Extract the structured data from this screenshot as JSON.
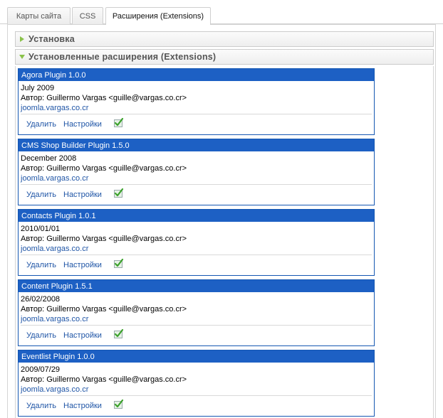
{
  "tabs": [
    {
      "label": "Карты сайта",
      "active": false
    },
    {
      "label": "CSS",
      "active": false
    },
    {
      "label": "Расширения (Extensions)",
      "active": true
    }
  ],
  "sections": {
    "install": {
      "title": "Установка",
      "expanded": false
    },
    "installed": {
      "title": "Установленные расширения (Extensions)",
      "expanded": true
    }
  },
  "colors": {
    "card_header": "#1d60c4",
    "link": "#1f55a6",
    "triangle": "#8ac24a"
  },
  "extensions": [
    {
      "title": "Agora Plugin 1.0.0",
      "date": "July 2009",
      "author": "Автор: Guillermo Vargas <guille@vargas.co.cr>",
      "url": "joomla.vargas.co.cr",
      "remove_label": "Удалить",
      "settings_label": "Настройки",
      "status_icon": "enabled-check-icon"
    },
    {
      "title": "CMS Shop Builder Plugin 1.5.0",
      "date": "December 2008",
      "author": "Автор: Guillermo Vargas <guille@vargas.co.cr>",
      "url": "joomla.vargas.co.cr",
      "remove_label": "Удалить",
      "settings_label": "Настройки",
      "status_icon": "enabled-check-icon"
    },
    {
      "title": "Contacts Plugin 1.0.1",
      "date": "2010/01/01",
      "author": "Автор: Guillermo Vargas <guille@vargas.co.cr>",
      "url": "joomla.vargas.co.cr",
      "remove_label": "Удалить",
      "settings_label": "Настройки",
      "status_icon": "enabled-check-icon"
    },
    {
      "title": "Content Plugin 1.5.1",
      "date": "26/02/2008",
      "author": "Автор: Guillermo Vargas <guille@vargas.co.cr>",
      "url": "joomla.vargas.co.cr",
      "remove_label": "Удалить",
      "settings_label": "Настройки",
      "status_icon": "enabled-check-icon"
    },
    {
      "title": "Eventlist Plugin 1.0.0",
      "date": "2009/07/29",
      "author": "Автор: Guillermo Vargas <guille@vargas.co.cr>",
      "url": "joomla.vargas.co.cr",
      "remove_label": "Удалить",
      "settings_label": "Настройки",
      "status_icon": "enabled-check-icon"
    }
  ]
}
